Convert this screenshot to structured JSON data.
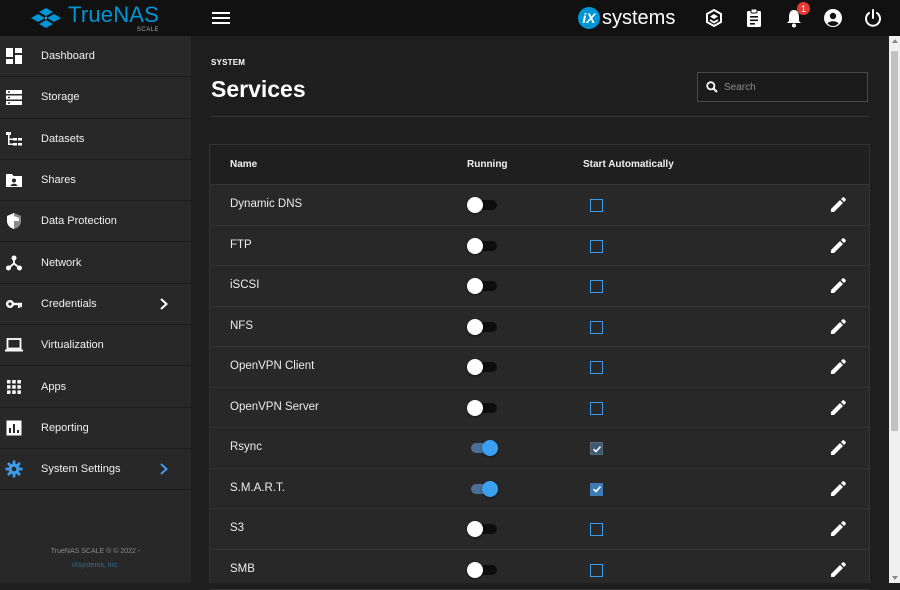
{
  "app": {
    "brand_name": "TrueNAS",
    "brand_sub": "SCALE",
    "vendor": "systems",
    "vendor_mark": "iX",
    "notification_count": "1"
  },
  "sidebar": {
    "items": [
      {
        "label": "Dashboard",
        "icon": "dashboard-icon"
      },
      {
        "label": "Storage",
        "icon": "storage-icon"
      },
      {
        "label": "Datasets",
        "icon": "datasets-icon"
      },
      {
        "label": "Shares",
        "icon": "shares-icon"
      },
      {
        "label": "Data Protection",
        "icon": "shield-icon"
      },
      {
        "label": "Network",
        "icon": "network-icon"
      },
      {
        "label": "Credentials",
        "icon": "key-icon"
      },
      {
        "label": "Virtualization",
        "icon": "laptop-icon"
      },
      {
        "label": "Apps",
        "icon": "apps-grid-icon"
      },
      {
        "label": "Reporting",
        "icon": "reporting-icon"
      },
      {
        "label": "System Settings",
        "icon": "gear-icon"
      }
    ],
    "footer_line1": "TrueNAS SCALE ® © 2022 -",
    "footer_line2": "iXsystems, Inc."
  },
  "page": {
    "breadcrumb": "SYSTEM",
    "title": "Services",
    "search_placeholder": "Search"
  },
  "table": {
    "headers": {
      "name": "Name",
      "running": "Running",
      "start": "Start Automatically"
    },
    "rows": [
      {
        "name": "Dynamic DNS",
        "running": false,
        "start": false
      },
      {
        "name": "FTP",
        "running": false,
        "start": false
      },
      {
        "name": "iSCSI",
        "running": false,
        "start": false
      },
      {
        "name": "NFS",
        "running": false,
        "start": false
      },
      {
        "name": "OpenVPN Client",
        "running": false,
        "start": false
      },
      {
        "name": "OpenVPN Server",
        "running": false,
        "start": false
      },
      {
        "name": "Rsync",
        "running": true,
        "start": true
      },
      {
        "name": "S.M.A.R.T.",
        "running": true,
        "start": true
      },
      {
        "name": "S3",
        "running": false,
        "start": false
      },
      {
        "name": "SMB",
        "running": false,
        "start": false
      }
    ]
  },
  "colors": {
    "accent": "#0095d5",
    "toggle_on": "#3aa0f0",
    "checkbox": "#3d9be9"
  }
}
